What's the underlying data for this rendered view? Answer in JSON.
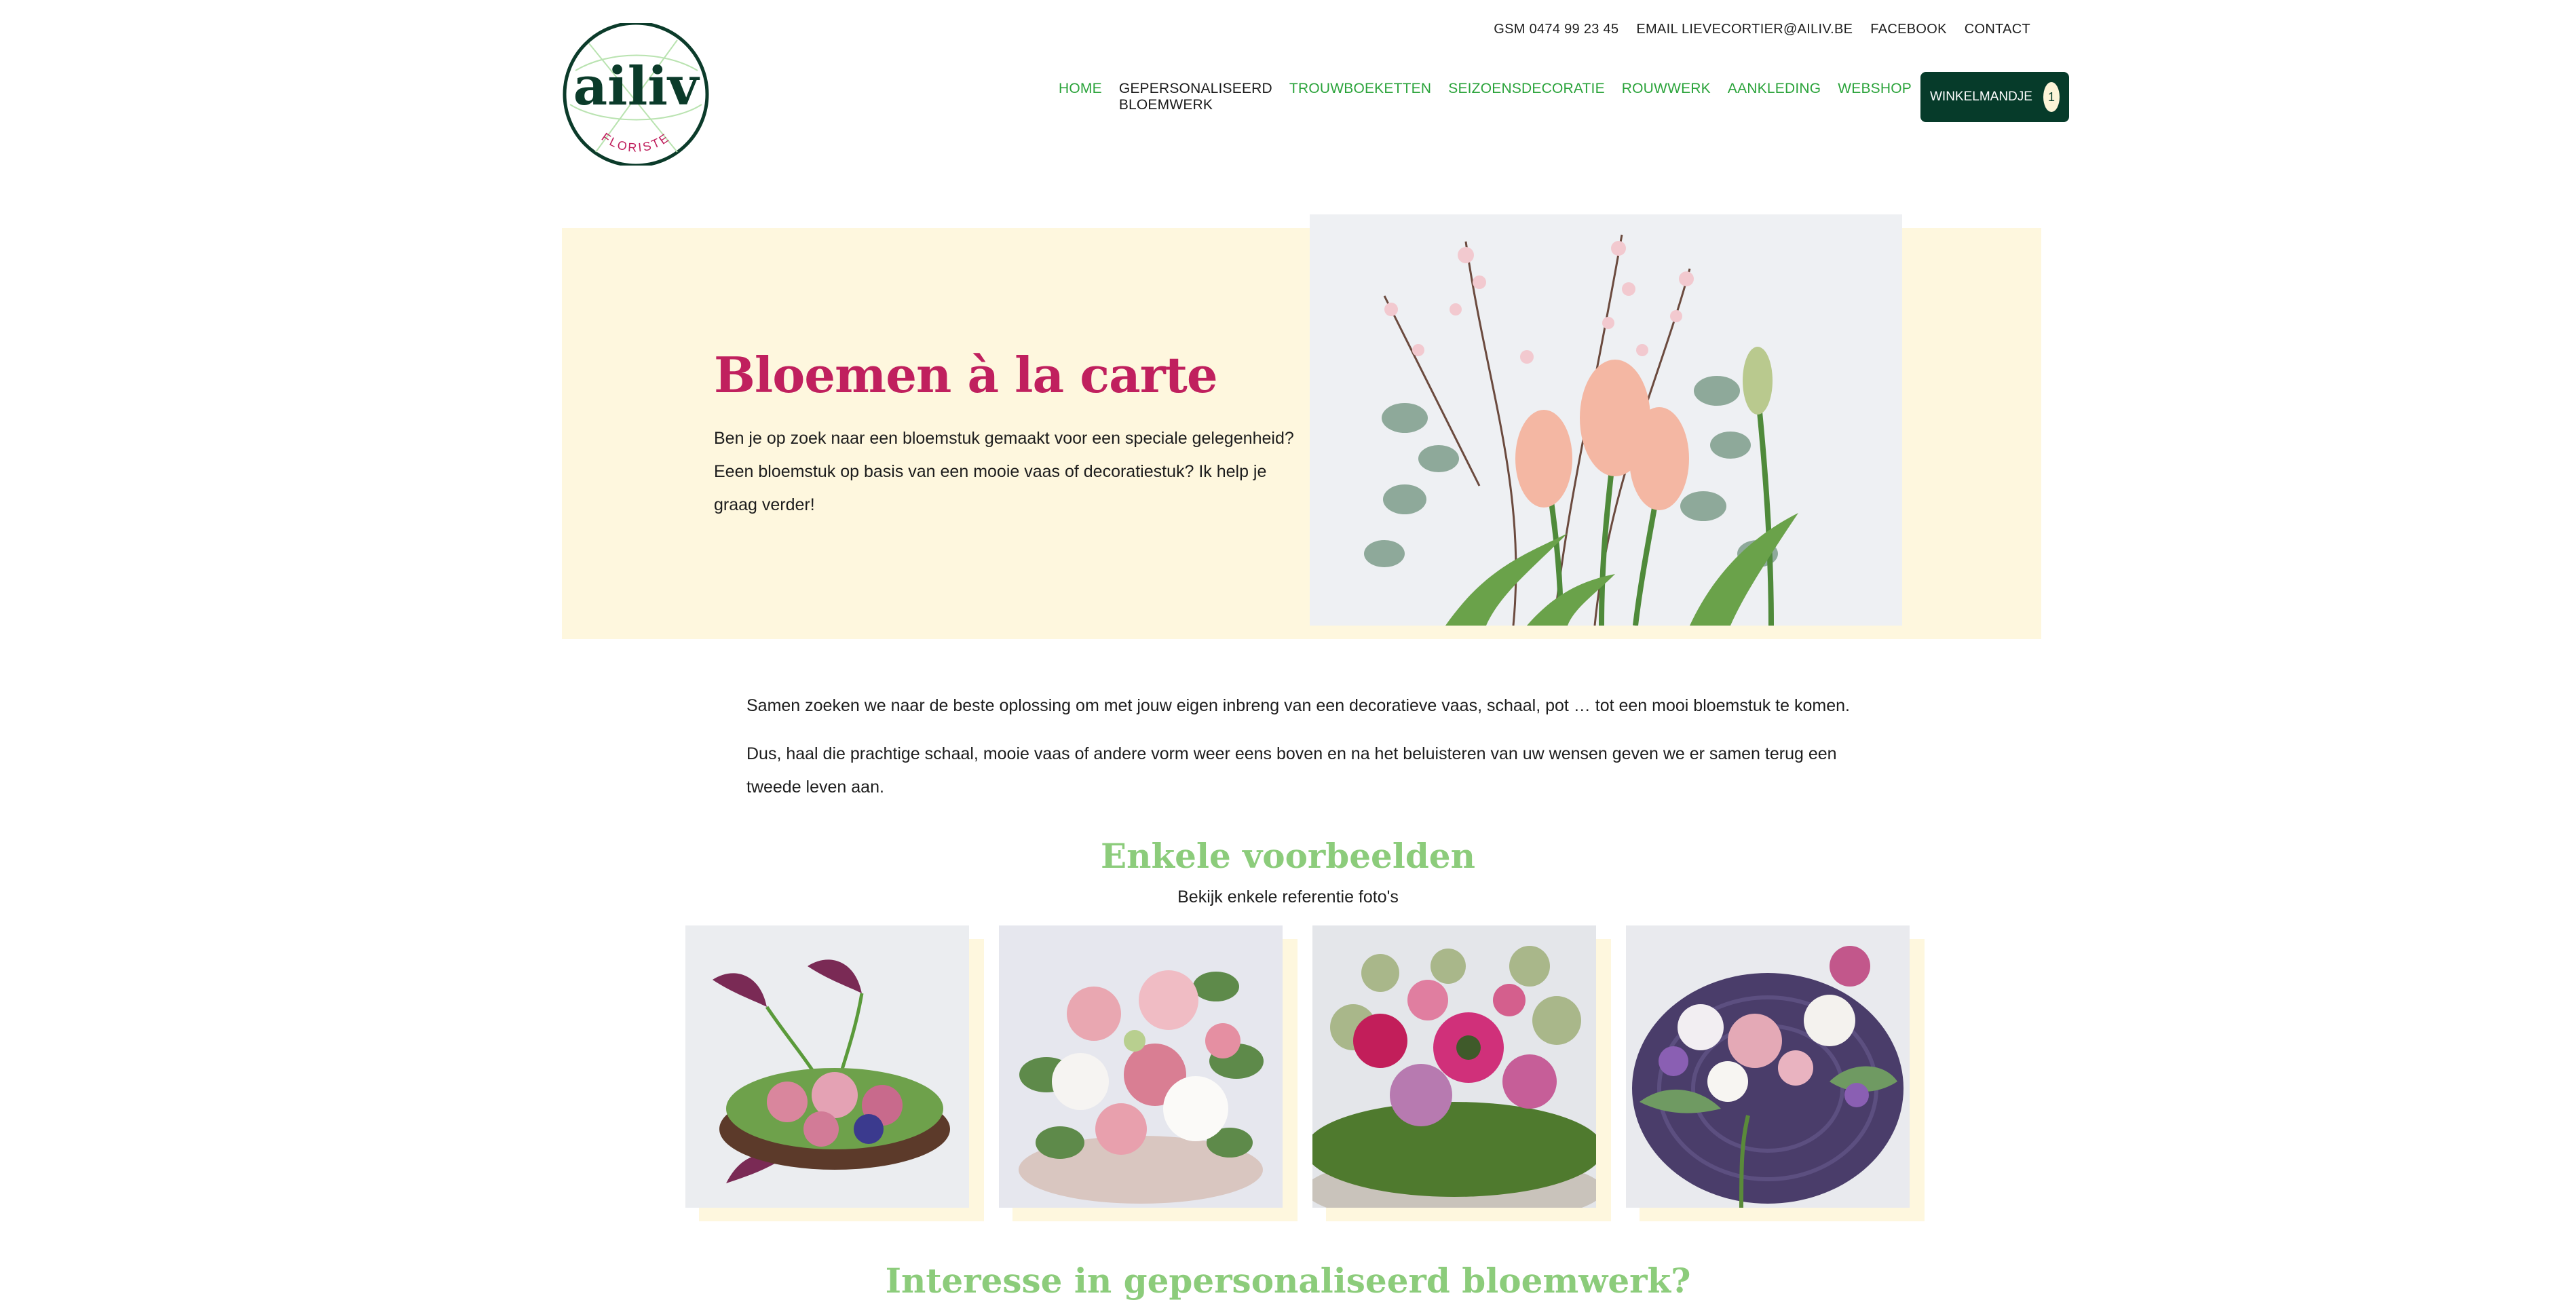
{
  "topbar": {
    "phone": "GSM 0474 99 23 45",
    "email": "EMAIL LIEVECORTIER@AILIV.BE",
    "facebook": "FACEBOOK",
    "contact": "CONTACT"
  },
  "logo": {
    "wordmark": "ailiv",
    "tagline": "FLORISTE"
  },
  "nav": {
    "items": [
      {
        "label": "HOME"
      },
      {
        "label": "GEPERSONALISEERD BLOEMWERK"
      },
      {
        "label": "TROUWBOEKETTEN"
      },
      {
        "label": "SEIZOENSDECORATIE"
      },
      {
        "label": "ROUWWERK"
      },
      {
        "label": "AANKLEDING"
      },
      {
        "label": "WEBSHOP"
      }
    ],
    "active_index": 1,
    "cart_label": "WINKELMANDJE",
    "cart_count": "1"
  },
  "hero": {
    "title": "Bloemen à la carte",
    "text": "Ben je op zoek naar een bloemstuk gemaakt voor een speciale gelegenheid? Eeen bloemstuk op basis van een mooie vaas of decoratiestuk? Ik help je graag verder!"
  },
  "intro": {
    "p1": "Samen zoeken we naar de beste oplossing om met jouw eigen inbreng van een decoratieve vaas, schaal, pot … tot een mooi bloemstuk te komen.",
    "p2": "Dus, haal die prachtige schaal, mooie vaas of andere vorm weer eens boven en na het beluisteren van uw wensen geven we er samen terug een tweede leven aan."
  },
  "examples": {
    "title": "Enkele voorbeelden",
    "subtitle": "Bekijk enkele referentie foto's"
  },
  "interest": {
    "title": "Interesse in gepersonaliseerd bloemwerk?"
  },
  "colors": {
    "brand_green": "#2aa33a",
    "dark_green": "#063b2a",
    "cream": "#fef7de",
    "magenta": "#c0205e",
    "light_green": "#8ccc7b"
  }
}
